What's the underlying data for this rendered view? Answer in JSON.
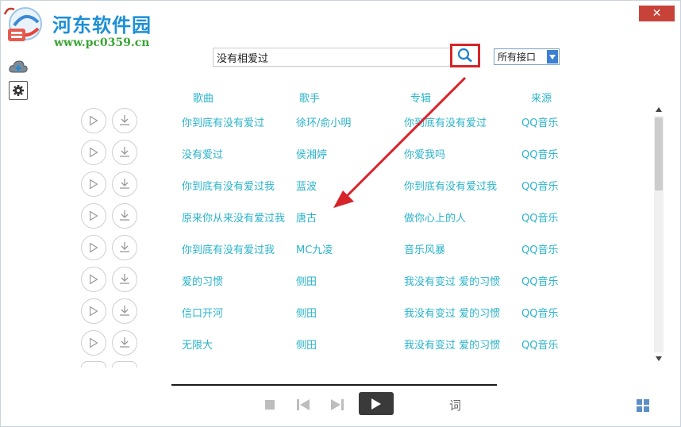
{
  "watermark": {
    "title": "河东软件园",
    "url": "www.pc0359.cn"
  },
  "sidebar": {
    "items": [
      {
        "icon": "cloud-download-icon"
      },
      {
        "icon": "gear-icon"
      }
    ]
  },
  "window": {
    "close_label": "✕"
  },
  "search": {
    "value": "没有相爱过",
    "button_icon": "search-icon"
  },
  "source_select": {
    "selected": "所有接口"
  },
  "table": {
    "columns": [
      "歌曲",
      "歌手",
      "专辑",
      "来源"
    ],
    "rows": [
      {
        "song": "你到底有没有爱过",
        "artist": "徐环/俞小明",
        "album": "你到底有没有爱过",
        "source": "QQ音乐"
      },
      {
        "song": "没有爱过",
        "artist": "侯湘婷",
        "album": "你爱我吗",
        "source": "QQ音乐"
      },
      {
        "song": "你到底有没有爱过我",
        "artist": "蓝波",
        "album": "你到底有没有爱过我",
        "source": "QQ音乐"
      },
      {
        "song": "原来你从来没有爱过我",
        "artist": "唐古",
        "album": "做你心上的人",
        "source": "QQ音乐"
      },
      {
        "song": "你到底有没有爱过我",
        "artist": "MC九凌",
        "album": "音乐风暴",
        "source": "QQ音乐"
      },
      {
        "song": "爱的习惯",
        "artist": "侧田",
        "album": "我没有变过 爱的习惯",
        "source": "QQ音乐"
      },
      {
        "song": "信口开河",
        "artist": "侧田",
        "album": "我没有变过 爱的习惯",
        "source": "QQ音乐"
      },
      {
        "song": "无限大",
        "artist": "侧田",
        "album": "我没有变过 爱的习惯",
        "source": "QQ音乐"
      }
    ]
  },
  "player": {
    "lyrics_label": "词"
  },
  "colors": {
    "accent_text": "#2bb3c9",
    "close_red": "#c7433a",
    "highlight_box": "#d6242a",
    "play_button": "#3a3a3a"
  }
}
